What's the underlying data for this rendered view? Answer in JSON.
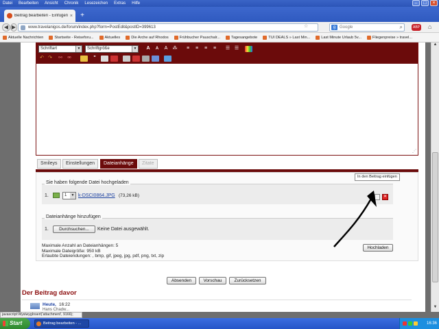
{
  "menu": [
    "Datei",
    "Bearbeiten",
    "Ansicht",
    "Chronik",
    "Lesezeichen",
    "Extras",
    "Hilfe"
  ],
  "browser_tab": {
    "title": "Beitrag bearbeiten - Einfügen...",
    "close": "×",
    "new_tab": "+"
  },
  "window_controls": {
    "minimize": "–",
    "maximize": "□",
    "close": "×"
  },
  "nav": {
    "back": "◀",
    "forward": "▶",
    "url": "www.travelanigos.de/forum/index.php?form=PostEdit&postID=399613",
    "search_placeholder": "Google"
  },
  "bookmarks": [
    "Aktuelle Nachrichten",
    "Startseite - Reiseforu...",
    "Aktuelles",
    "Die Arche auf Rhodos",
    "Frühbucher Pauschalr...",
    "Tagesangebote",
    "TUI DEALS » Last Min...",
    "Last Minute Urlaub 5v...",
    "Fliegenpreise » travel..."
  ],
  "editor": {
    "font_select": "Schriftart",
    "size_select": "Schriftgröße",
    "tabs": [
      "Smileys",
      "Einstellungen",
      "Dateianhänge",
      "Zitate"
    ],
    "active_tab": "Dateianhänge"
  },
  "attachments": {
    "uploaded_legend": "Sie haben folgende Datei hochgeladen",
    "file_index": "1.",
    "position_select": "1",
    "file_name": "k-DSCI0864.JPG",
    "file_size": "(73,26 kB)",
    "tooltip": "In den Beitrag einfügen",
    "add_legend": "Dateianhänge hinzufügen",
    "add_index": "1.",
    "browse_button": "Durchsuchen...",
    "no_file": "Keine Datei ausgewählt.",
    "max_count": "Maximale Anzahl an Dateianhängen: 5",
    "max_size": "Maximale Dateigröße: 950 kB",
    "allowed_ext": "Erlaubte Dateiendungen: , bmp, gif, jpeg, jpg, pdf, png, txt, zip",
    "upload_button": "Hochladen"
  },
  "form_buttons": {
    "submit": "Absenden",
    "preview": "Vorschau",
    "reset": "Zurücksetzen"
  },
  "previous_post": {
    "heading": "Der Beitrag davor",
    "date_label": "Heute,",
    "time": "16:22",
    "author": "Hans Chadw..."
  },
  "status_url": "javascript:WysiwygInsert('attachment', 9166);",
  "taskbar": {
    "start": "Start",
    "task": "Beitrag bearbeiten - ...",
    "clock": "16:36"
  },
  "colors": {
    "editor_toolbar": "#6b0b0b",
    "heading": "#8b0c0c",
    "titlebar": "#2c55b8"
  }
}
